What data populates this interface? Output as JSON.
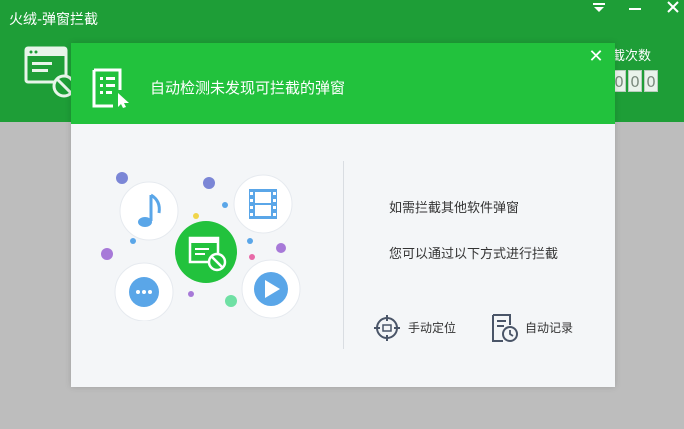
{
  "window": {
    "title": "火绒-弹窗拦截",
    "controls": {
      "menu_icon": "dropdown-icon",
      "minimize_icon": "minimize-icon",
      "close_icon": "close-icon"
    },
    "stats": {
      "label": "截次数",
      "digits": [
        "0",
        "0",
        "0"
      ]
    }
  },
  "popup": {
    "title": "自动检测未发现可拦截的弹窗",
    "close_symbol": "✕",
    "messages": [
      "如需拦截其他软件弹窗",
      "您可以通过以下方式进行拦截"
    ],
    "actions": [
      {
        "label": "手动定位",
        "icon": "crosshair-icon"
      },
      {
        "label": "自动记录",
        "icon": "clock-record-icon"
      }
    ]
  },
  "colors": {
    "window_header": "#1e9e37",
    "popup_header": "#22c23d",
    "popup_body": "#f4f6f8",
    "overlay_bg": "#bdbdbd",
    "music_bubble": "#5aa6e8",
    "chat_bubble": "#5aa6e8",
    "play_bubble": "#5aa6e8",
    "block_center": "#22c23d"
  }
}
